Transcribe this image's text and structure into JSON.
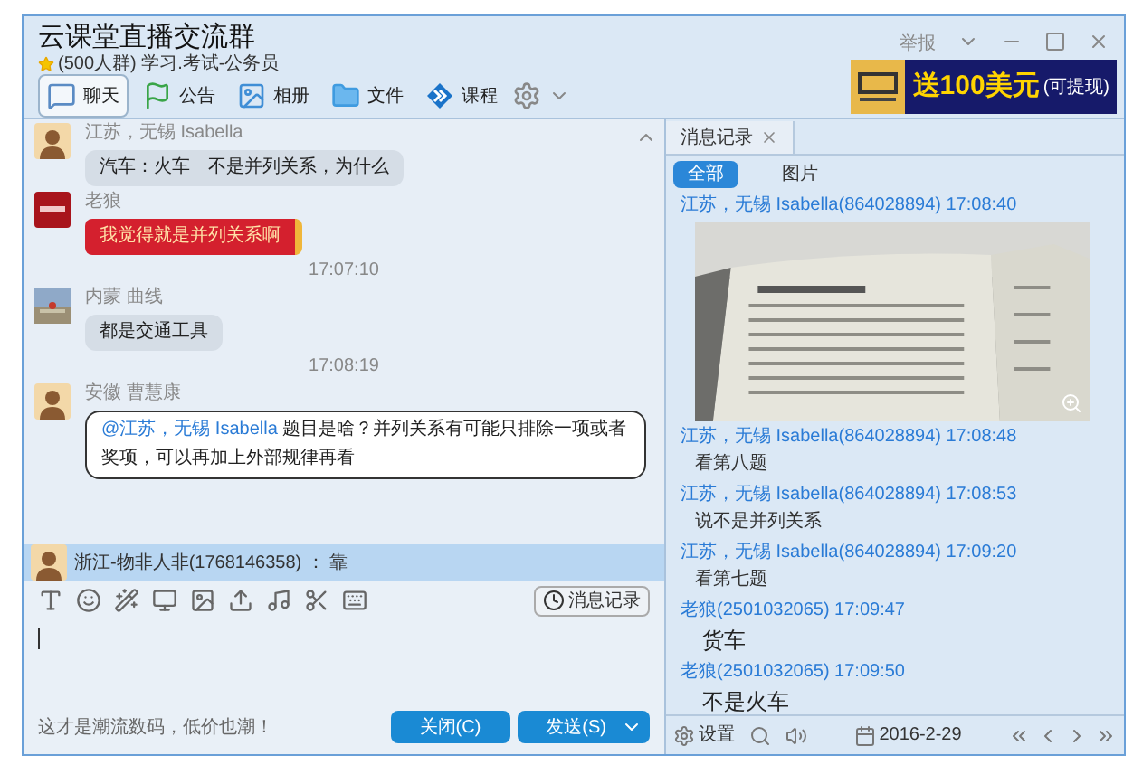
{
  "window": {
    "title": "云课堂直播交流群",
    "subtitle": "(500人群) 学习.考试-公务员",
    "report": "举报"
  },
  "tabs": [
    {
      "label": "聊天",
      "selected": true,
      "kind": "chat"
    },
    {
      "label": "公告",
      "selected": false,
      "kind": "notice"
    },
    {
      "label": "相册",
      "selected": false,
      "kind": "album"
    },
    {
      "label": "文件",
      "selected": false,
      "kind": "file"
    },
    {
      "label": "课程",
      "selected": false,
      "kind": "course"
    }
  ],
  "ad": {
    "headline": "送100美元",
    "note": "(可提现)"
  },
  "messages": [
    {
      "kind": "plain",
      "sender": "江苏，无锡 Isabella",
      "text": "汽车：火车　不是并列关系，为什么"
    },
    {
      "kind": "highlight",
      "sender": "老狼",
      "text": "我觉得就是并列关系啊"
    },
    {
      "kind": "time",
      "text": "17:07:10"
    },
    {
      "kind": "plain",
      "sender": "内蒙  曲线",
      "text": "都是交通工具"
    },
    {
      "kind": "time",
      "text": "17:08:19"
    },
    {
      "kind": "mention",
      "sender": "安徽 曹慧康",
      "mention": "@江苏，无锡 Isabella",
      "text": "题目是啥？并列关系有可能只排除一项或者奖项，可以再加上外部规律再看"
    }
  ],
  "notice_banner": {
    "text": "浙江-物非人非(1768146358) ： 靠"
  },
  "history_button": "消息记录",
  "footer": {
    "ad_text": "这才是潮流数码，低价也潮！",
    "close": "关闭(C)",
    "send": "发送(S)"
  },
  "history": {
    "tab": "消息记录",
    "filters": [
      {
        "label": "全部",
        "selected": true
      },
      {
        "label": "图片",
        "selected": false
      }
    ],
    "records": [
      {
        "header": "江苏，无锡 Isabella(864028894) 17:08:40",
        "kind": "picture"
      },
      {
        "header": "江苏，无锡 Isabella(864028894) 17:08:48",
        "kind": "text",
        "text": "看第八题"
      },
      {
        "header": "江苏，无锡 Isabella(864028894) 17:08:53",
        "kind": "text",
        "text": "说不是并列关系"
      },
      {
        "header": "江苏，无锡 Isabella(864028894) 17:09:20",
        "kind": "text",
        "text": "看第七题"
      },
      {
        "header": "老狼(2501032065) 17:09:47",
        "kind": "large",
        "text": "货车"
      },
      {
        "header": "老狼(2501032065) 17:09:50",
        "kind": "large",
        "text": "不是火车"
      }
    ],
    "settings": "设置",
    "date": "2016-2-29"
  }
}
